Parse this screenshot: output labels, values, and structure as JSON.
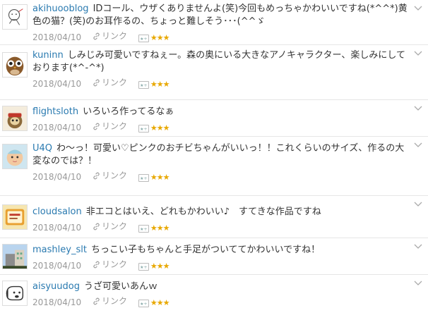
{
  "comments": [
    {
      "user": "akihuooblog",
      "text": "IDコール、ウザくありませんよ(笑)今回もめっちゃかわいいですね(*^^*)黄色の猫？(笑)のお耳作るの、ちょっと難しそう･･･(^^ゞ",
      "date": "2018/04/10",
      "link": "リンク",
      "stars": "★★★",
      "avatar": "doodle-avatar"
    },
    {
      "user": "kuninn",
      "text": "しみじみ可愛いですねぇー。森の奥にいる大きなアノキャラクター、楽しみにしております(*^-^*)",
      "date": "2018/04/10",
      "link": "リンク",
      "stars": "★★★",
      "avatar": "owl-avatar"
    },
    {
      "user": "flightsloth",
      "text": "いろいろ作ってるなぁ",
      "date": "2018/04/10",
      "link": "リンク",
      "stars": "★★★",
      "avatar": "sloth-avatar"
    },
    {
      "user": "U4Q",
      "text": "わ～っ！可愛い♡ピンクのおチビちゃんがいいっ！！これくらいのサイズ、作るの大変なのでは？！",
      "date": "2018/04/10",
      "link": "リンク",
      "stars": "★★★",
      "avatar": "baby-avatar"
    },
    {
      "user": "cloudsalon",
      "text": "非エコとはいえ、どれもかわいい♪　すてきな作品ですね",
      "date": "2018/04/10",
      "link": "リンク",
      "stars": "★★★",
      "avatar": "shop-avatar"
    },
    {
      "user": "mashley_slt",
      "text": "ちっこい子もちゃんと手足がついててかわいいですね！",
      "date": "2018/04/10",
      "link": "リンク",
      "stars": "★★★",
      "avatar": "building-avatar"
    },
    {
      "user": "aisyuudog",
      "text": "うざ可愛いあんｗ",
      "date": "2018/04/10",
      "link": "リンク",
      "stars": "★★★",
      "avatar": "dog-avatar"
    }
  ],
  "colors": {
    "username": "#2a7ab0",
    "stars": "#e8a800",
    "meta": "#999999"
  }
}
